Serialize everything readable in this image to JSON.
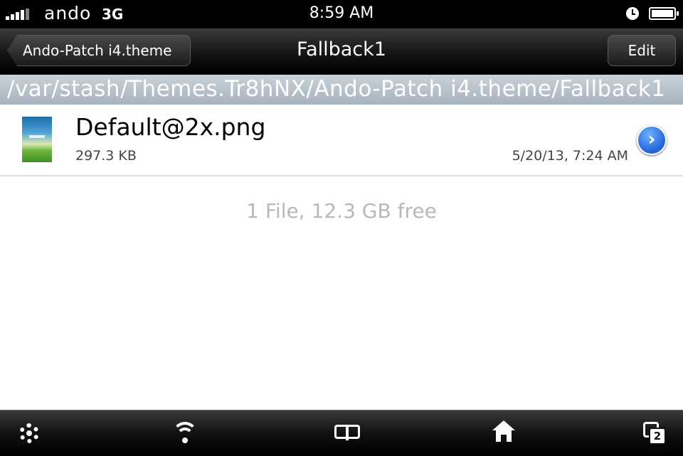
{
  "status_bar": {
    "carrier": "ando",
    "network": "3G",
    "time": "8:59 AM"
  },
  "nav": {
    "back_label": "Ando-Patch i4.theme",
    "title": "Fallback1",
    "edit_label": "Edit"
  },
  "path": "/var/stash/Themes.Tr8hNX/Ando-Patch i4.theme/Fallback1",
  "files": [
    {
      "name": "Default@2x.png",
      "size": "297.3 KB",
      "date": "5/20/13, 7:24 AM"
    }
  ],
  "footer": "1 File, 12.3 GB free",
  "tabbar": {
    "items": [
      "settings-icon",
      "wifi-icon",
      "bookmarks-icon",
      "home-icon",
      "windows-icon"
    ],
    "windows_count": "2"
  },
  "colors": {
    "path_bar": "#b5c0ca",
    "disclosure": "#1f63d6"
  }
}
